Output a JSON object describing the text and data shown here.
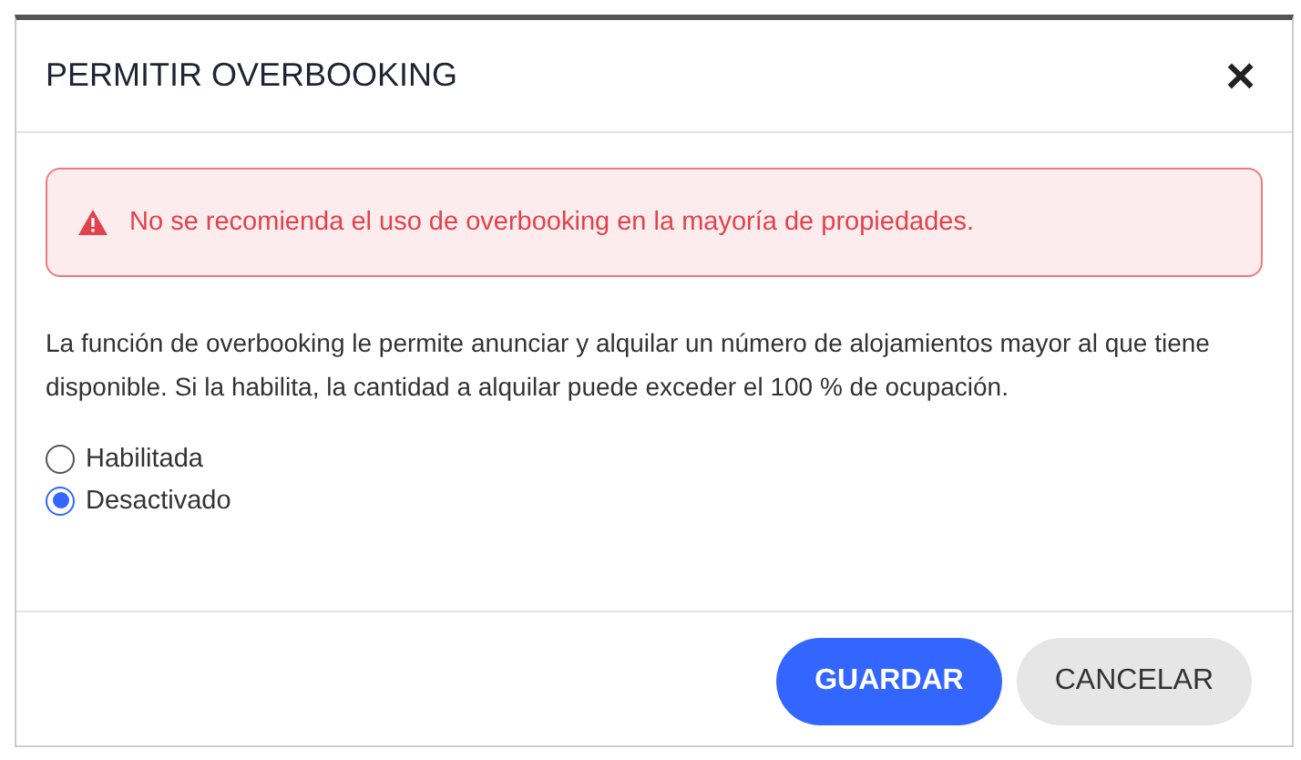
{
  "dialog": {
    "title": "PERMITIR OVERBOOKING",
    "close": "×"
  },
  "alert": {
    "text": "No se recomienda el uso de overbooking en la mayoría de propiedades."
  },
  "description": "La función de overbooking le permite anunciar y alquilar un número de alojamientos mayor al que tiene disponible. Si la habilita, la cantidad a alquilar puede exceder el 100 % de ocupación.",
  "options": [
    {
      "label": "Habilitada",
      "selected": false
    },
    {
      "label": "Desactivado",
      "selected": true
    }
  ],
  "buttons": [
    {
      "label": "GUARDAR",
      "kind": "primary"
    },
    {
      "label": "CANCELAR",
      "kind": "secondary"
    }
  ]
}
